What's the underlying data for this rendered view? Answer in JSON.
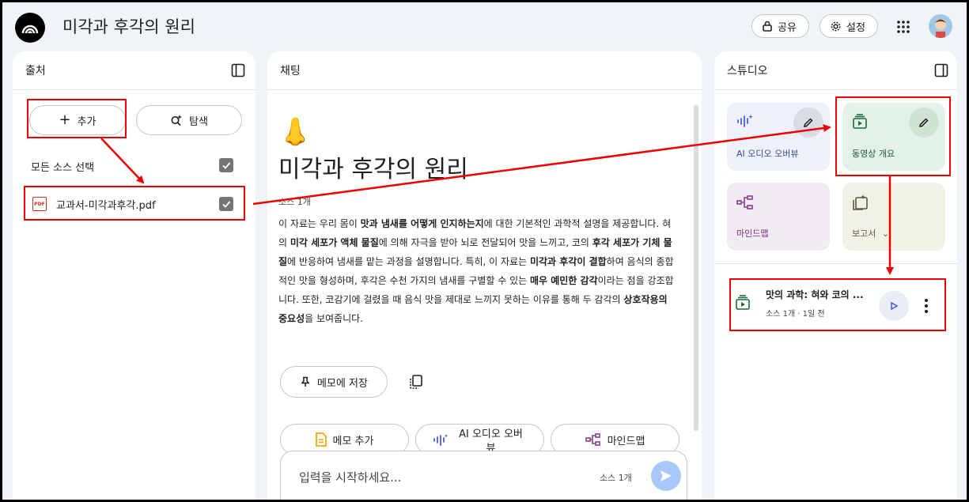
{
  "header": {
    "notebook_title": "미각과 후각의 원리",
    "share_label": "공유",
    "settings_label": "설정"
  },
  "sources": {
    "title": "출처",
    "add_label": "추가",
    "explore_label": "탐색",
    "select_all_label": "모든 소스 선택",
    "items": [
      {
        "name": "교과서-미각과후각.pdf",
        "type_badge": "PDF",
        "checked": true
      }
    ]
  },
  "chat": {
    "title": "채팅",
    "emoji": "👃",
    "heading": "미각과 후각의 원리",
    "source_count": "소스 1개",
    "summary_segments": [
      {
        "t": "이 자료는 우리 몸이 ",
        "b": false
      },
      {
        "t": "맛과 냄새를 어떻게 인지하는지",
        "b": true
      },
      {
        "t": "에 대한 기본적인 과학적 설명을 제공합니다. 혀의 ",
        "b": false
      },
      {
        "t": "미각 세포가 액체 물질",
        "b": true
      },
      {
        "t": "에 의해 자극을 받아 뇌로 전달되어 맛을 느끼고, 코의 ",
        "b": false
      },
      {
        "t": "후각 세포가 기체 물질",
        "b": true
      },
      {
        "t": "에 반응하여 냄새를 맡는 과정을 설명합니다. 특히, 이 자료는 ",
        "b": false
      },
      {
        "t": "미각과 후각이 결합",
        "b": true
      },
      {
        "t": "하여 음식의 종합적인 맛을 형성하며, 후각은 수천 가지의 냄새를 구별할 수 있는 ",
        "b": false
      },
      {
        "t": "매우 예민한 감각",
        "b": true
      },
      {
        "t": "이라는 점을 강조합니다. 또한, 코감기에 걸렸을 때 음식 맛을 제대로 느끼지 못하는 이유를 통해 두 감각의 ",
        "b": false
      },
      {
        "t": "상호작용의 중요성",
        "b": true
      },
      {
        "t": "을 보여줍니다.",
        "b": false
      }
    ],
    "save_note_label": "메모에 저장",
    "suggestion_chips": [
      "메모 추가",
      "AI 오디오 오버뷰",
      "마인드맵"
    ],
    "input_placeholder": "입력을 시작하세요...",
    "input_source_count": "소스 1개"
  },
  "studio": {
    "title": "스튜디오",
    "cards": [
      {
        "label": "AI 오디오 오버뷰",
        "icon": "audio-wave-icon"
      },
      {
        "label": "동영상 개요",
        "icon": "video-overview-icon"
      },
      {
        "label": "마인드맵",
        "icon": "mindmap-icon"
      },
      {
        "label": "보고서",
        "icon": "report-icon"
      }
    ],
    "generated_item": {
      "title": "맛의 과학: 혀와 코의 ...",
      "meta": "소스 1개 · 1일 전"
    }
  },
  "colors": {
    "annotation_red": "#e00000",
    "audio_card_bg": "#eef0fa",
    "video_card_bg": "#e3f2e8",
    "mindmap_card_bg": "#f3ebf2",
    "report_card_bg": "#f2f1e6"
  }
}
